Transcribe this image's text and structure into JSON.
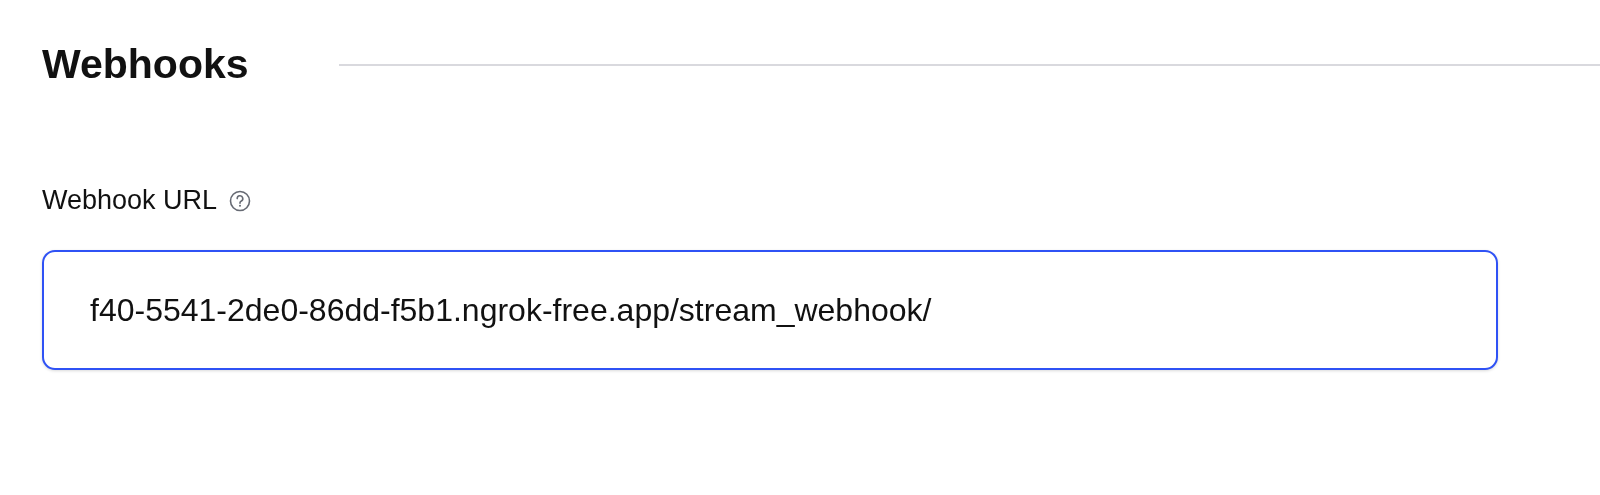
{
  "section": {
    "title": "Webhooks"
  },
  "field": {
    "label": "Webhook URL",
    "value": "f40-5541-2de0-86dd-f5b1.ngrok-free.app/stream_webhook/",
    "focused": true
  }
}
